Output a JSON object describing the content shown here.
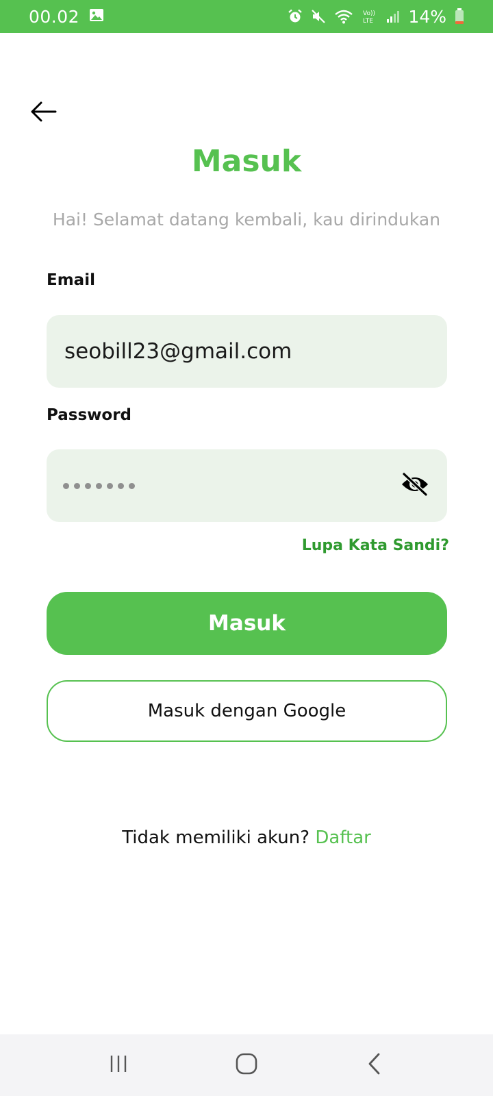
{
  "status_bar": {
    "time": "00.02",
    "battery_percent": "14%",
    "icons": [
      "gallery-icon",
      "alarm-icon",
      "mute-icon",
      "wifi-icon",
      "volte-icon",
      "signal-icon",
      "battery-icon"
    ],
    "background_color": "#56c150"
  },
  "header": {
    "back_icon": "arrow-left-icon",
    "title": "Masuk",
    "subtitle": "Hai! Selamat datang kembali, kau dirindukan"
  },
  "form": {
    "email_label": "Email",
    "email_value": "seobill23@gmail.com",
    "password_label": "Password",
    "password_masked_length": 7,
    "password_toggle_icon": "eye-off-icon",
    "forgot_password": "Lupa Kata Sandi?"
  },
  "actions": {
    "login_button": "Masuk",
    "google_button": "Masuk dengan Google"
  },
  "footer": {
    "no_account_text": "Tidak memiliki akun?",
    "signup_link": "Daftar"
  },
  "nav_bar": {
    "recent_icon": "recent-apps-icon",
    "home_icon": "home-icon",
    "back_icon": "nav-back-icon"
  },
  "colors": {
    "accent": "#56c150",
    "input_background": "#ebf3ea",
    "link_dark": "#2f9a2f",
    "subtitle_gray": "#a8a8a8"
  }
}
